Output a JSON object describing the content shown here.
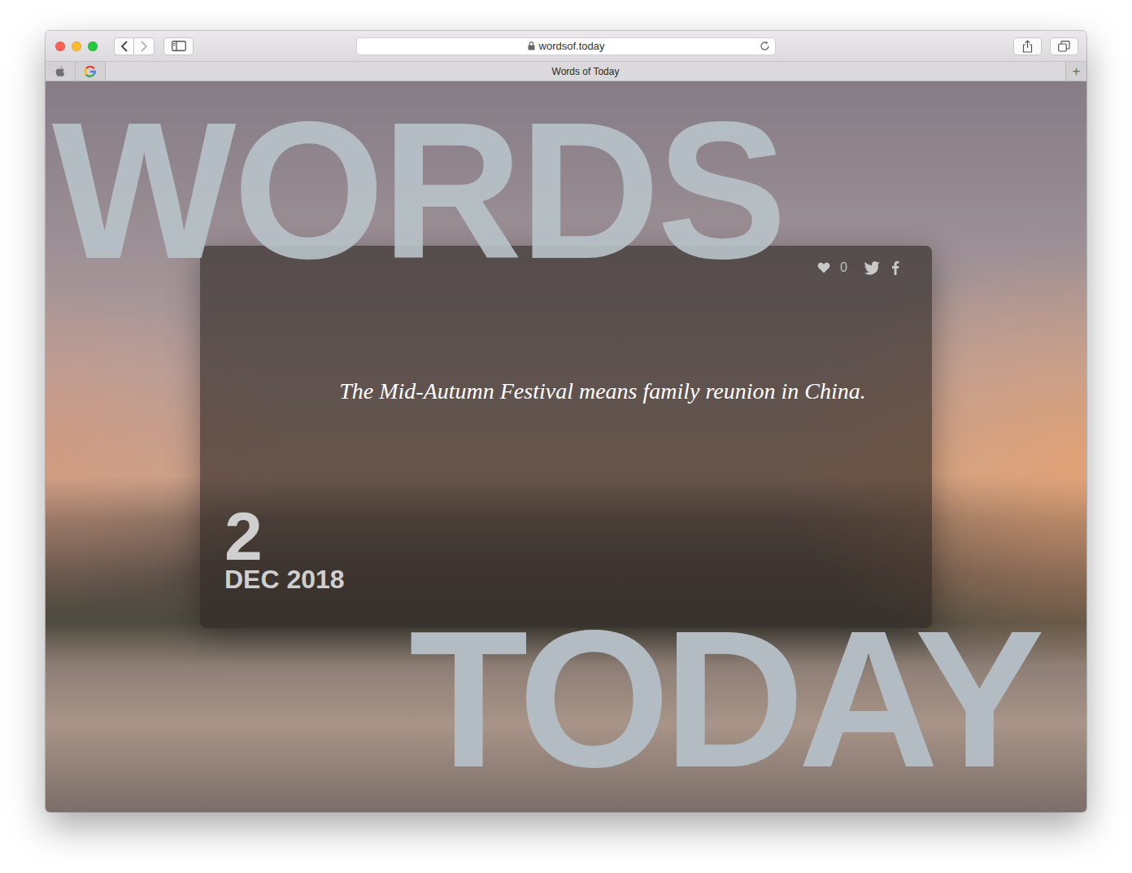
{
  "window": {
    "title": "Words of Today"
  },
  "toolbar": {
    "back_enabled": true,
    "forward_enabled": false
  },
  "address_bar": {
    "url": "wordsof.today",
    "secure": true
  },
  "tabs": [
    {
      "label": "Words of Today",
      "selected": true
    }
  ],
  "new_tab_button": "+",
  "page": {
    "heading_top": "WORDS",
    "heading_bottom": "TODAY",
    "card": {
      "likes": "0",
      "quote": "The Mid-Autumn Festival means family reunion in China.",
      "day": "2",
      "month_year": "DEC 2018"
    }
  }
}
